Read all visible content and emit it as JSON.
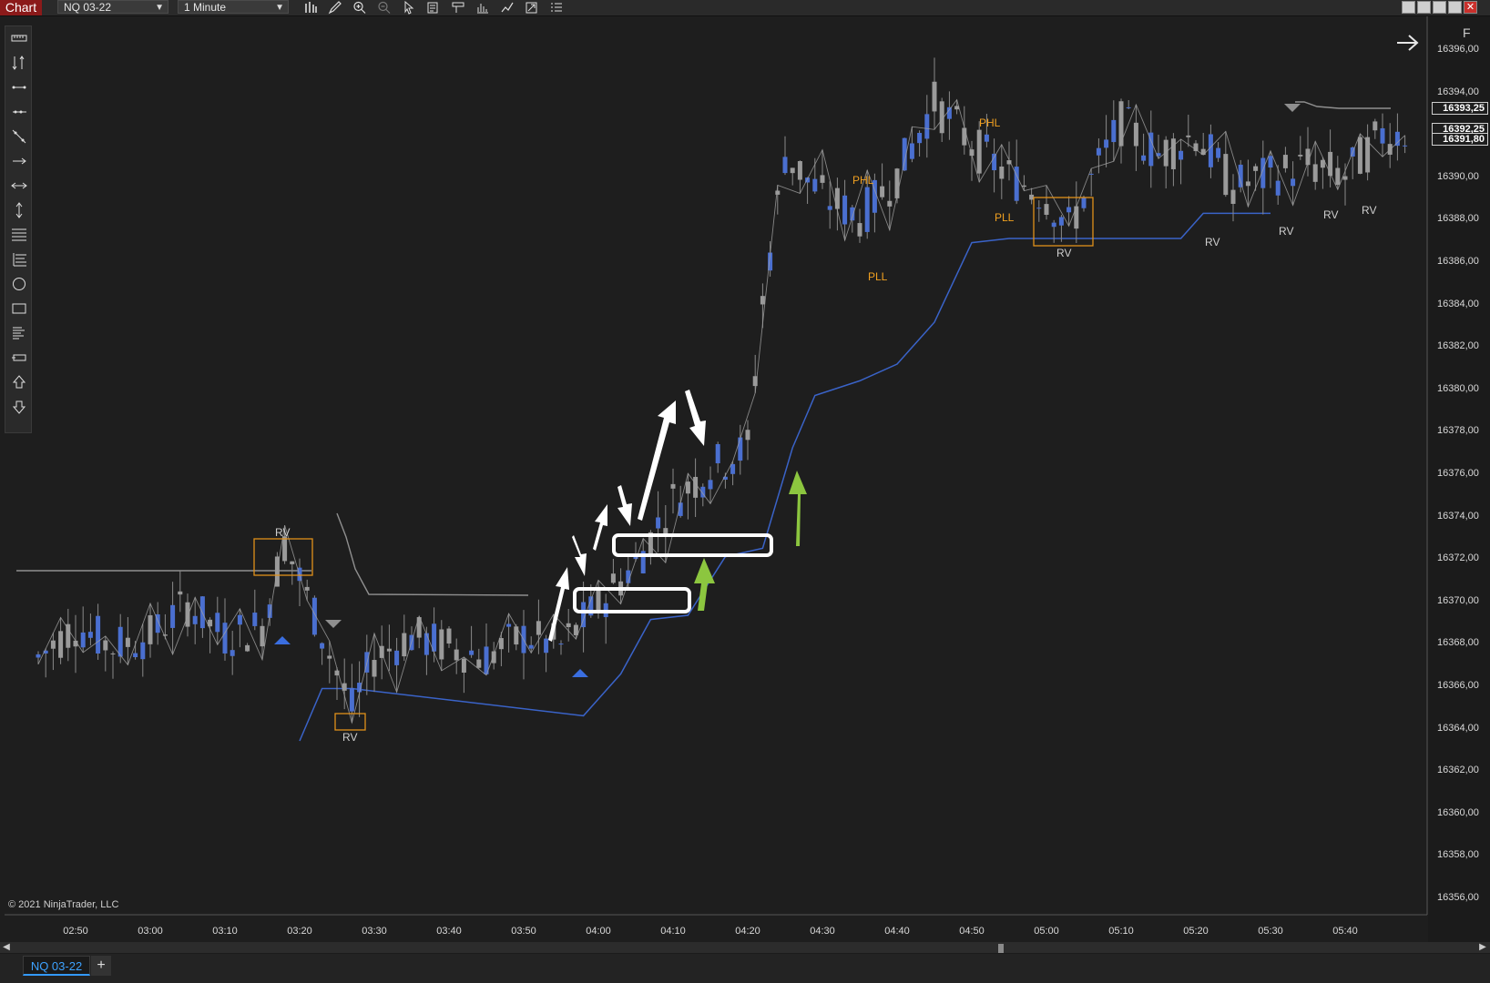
{
  "window": {
    "title_badge": "Chart",
    "instrument": "NQ 03-22",
    "interval": "1 Minute"
  },
  "toolbar_icons": [
    "bar-type-icon",
    "pencil-icon",
    "zoom-in-icon",
    "zoom-out-icon",
    "pointer-icon",
    "properties-icon",
    "templates-icon",
    "indicators-icon",
    "strategies-icon",
    "chart-trader-icon",
    "more-icon"
  ],
  "drawing_tools": [
    "ruler-icon",
    "risk-reward-icon",
    "line-icon",
    "ray-icon",
    "extended-line-icon",
    "arrow-line-icon",
    "horizontal-line-icon",
    "vertical-line-icon",
    "fibonacci-retracement-icon",
    "fibonacci-extension-icon",
    "ellipse-icon",
    "rectangle-icon",
    "region-highlight-icon",
    "text-icon",
    "arrow-up-icon",
    "arrow-down-icon"
  ],
  "f_button": "F",
  "copyright": "© 2021 NinjaTrader, LLC",
  "tab": {
    "label": "NQ 03-22",
    "add": "+"
  },
  "price_axis": {
    "labels": [
      "16396,00",
      "16394,00",
      "16392,00",
      "16390,00",
      "16388,00",
      "16386,00",
      "16384,00",
      "16382,00",
      "16380,00",
      "16378,00",
      "16376,00",
      "16374,00",
      "16372,00",
      "16370,00",
      "16368,00",
      "16366,00",
      "16364,00",
      "16362,00",
      "16360,00",
      "16358,00",
      "16356,00"
    ],
    "last_price_tags": [
      "16393,25",
      "16392,25",
      "16391,80"
    ]
  },
  "time_axis": {
    "labels": [
      "02:50",
      "03:00",
      "03:10",
      "03:20",
      "03:30",
      "03:40",
      "03:50",
      "04:00",
      "04:10",
      "04:20",
      "04:30",
      "04:40",
      "04:50",
      "05:00",
      "05:10",
      "05:20",
      "05:30",
      "05:40"
    ]
  },
  "annotations": {
    "rv": "RV",
    "phl": "PHL",
    "pll": "PLL"
  },
  "colors": {
    "background": "#1e1e1e",
    "up_candle": "#4a6fd0",
    "down_candle": "#9a9a9a",
    "stop_line": "#3a63c8",
    "zigzag": "#a0a0a0",
    "orange_box": "#e0901a",
    "label_orange": "#f0a020",
    "green_arrow": "#8cc63f",
    "white_arrow": "#ffffff"
  },
  "chart_data": {
    "type": "candlestick",
    "instrument": "NQ 03-22",
    "interval": "1 Minute",
    "y_range": [
      16355,
      16397
    ],
    "x_range": [
      "02:45",
      "05:48"
    ],
    "price_path": [
      {
        "t": "02:45",
        "p": 16367.0
      },
      {
        "t": "02:50",
        "p": 16368.5
      },
      {
        "t": "02:55",
        "p": 16367.5
      },
      {
        "t": "03:00",
        "p": 16368.0
      },
      {
        "t": "03:05",
        "p": 16369.5
      },
      {
        "t": "03:10",
        "p": 16368.0
      },
      {
        "t": "03:15",
        "p": 16368.5
      },
      {
        "t": "03:18",
        "p": 16372.5
      },
      {
        "t": "03:22",
        "p": 16369.0
      },
      {
        "t": "03:27",
        "p": 16364.5
      },
      {
        "t": "03:30",
        "p": 16367.0
      },
      {
        "t": "03:35",
        "p": 16368.0
      },
      {
        "t": "03:40",
        "p": 16367.5
      },
      {
        "t": "03:45",
        "p": 16367.0
      },
      {
        "t": "03:50",
        "p": 16368.0
      },
      {
        "t": "03:55",
        "p": 16367.5
      },
      {
        "t": "04:00",
        "p": 16369.5
      },
      {
        "t": "04:05",
        "p": 16371.5
      },
      {
        "t": "04:10",
        "p": 16374.5
      },
      {
        "t": "04:15",
        "p": 16376.0
      },
      {
        "t": "04:20",
        "p": 16377.0
      },
      {
        "t": "04:22",
        "p": 16384.0
      },
      {
        "t": "04:25",
        "p": 16391.0
      },
      {
        "t": "04:30",
        "p": 16389.0
      },
      {
        "t": "04:35",
        "p": 16388.0
      },
      {
        "t": "04:40",
        "p": 16390.0
      },
      {
        "t": "04:45",
        "p": 16393.5
      },
      {
        "t": "04:50",
        "p": 16391.5
      },
      {
        "t": "04:55",
        "p": 16390.0
      },
      {
        "t": "05:00",
        "p": 16389.0
      },
      {
        "t": "05:03",
        "p": 16387.5
      },
      {
        "t": "05:07",
        "p": 16390.5
      },
      {
        "t": "05:10",
        "p": 16392.5
      },
      {
        "t": "05:15",
        "p": 16391.0
      },
      {
        "t": "05:20",
        "p": 16392.0
      },
      {
        "t": "05:25",
        "p": 16389.5
      },
      {
        "t": "05:30",
        "p": 16390.0
      },
      {
        "t": "05:35",
        "p": 16390.5
      },
      {
        "t": "05:40",
        "p": 16390.0
      },
      {
        "t": "05:45",
        "p": 16392.0
      }
    ],
    "stop_line": [
      {
        "t": "03:20",
        "p": 16363.0
      },
      {
        "t": "03:23",
        "p": 16365.5
      },
      {
        "t": "03:27",
        "p": 16365.5
      },
      {
        "t": "03:58",
        "p": 16364.2
      },
      {
        "t": "04:03",
        "p": 16366.2
      },
      {
        "t": "04:07",
        "p": 16368.8
      },
      {
        "t": "04:12",
        "p": 16369.0
      },
      {
        "t": "04:17",
        "p": 16371.8
      },
      {
        "t": "04:22",
        "p": 16372.2
      },
      {
        "t": "04:26",
        "p": 16377.0
      },
      {
        "t": "04:29",
        "p": 16379.5
      },
      {
        "t": "04:35",
        "p": 16380.2
      },
      {
        "t": "04:40",
        "p": 16381.0
      },
      {
        "t": "04:45",
        "p": 16383.0
      },
      {
        "t": "04:50",
        "p": 16386.8
      },
      {
        "t": "04:55",
        "p": 16387.0
      },
      {
        "t": "05:18",
        "p": 16387.0
      },
      {
        "t": "05:21",
        "p": 16388.2
      },
      {
        "t": "05:30",
        "p": 16388.2
      }
    ],
    "rv_marks": [
      {
        "label": "RV",
        "t": "03:18",
        "p": 16373.0
      },
      {
        "label": "RV",
        "t": "03:27",
        "p": 16363.8
      },
      {
        "label": "RV",
        "t": "05:03",
        "p": 16386.8
      },
      {
        "label": "RV",
        "t": "05:22",
        "p": 16387.2
      },
      {
        "label": "RV",
        "t": "05:33",
        "p": 16387.8
      },
      {
        "label": "RV",
        "t": "05:38",
        "p": 16388.3
      },
      {
        "label": "RV",
        "t": "05:43",
        "p": 16388.5
      }
    ],
    "swing_labels": [
      {
        "label": "PHL",
        "t": "04:34",
        "p": 16390.0
      },
      {
        "label": "PLL",
        "t": "04:36",
        "p": 16385.0
      },
      {
        "label": "PHL",
        "t": "04:53",
        "p": 16393.0
      },
      {
        "label": "PLL",
        "t": "04:55",
        "p": 16388.2
      }
    ]
  }
}
